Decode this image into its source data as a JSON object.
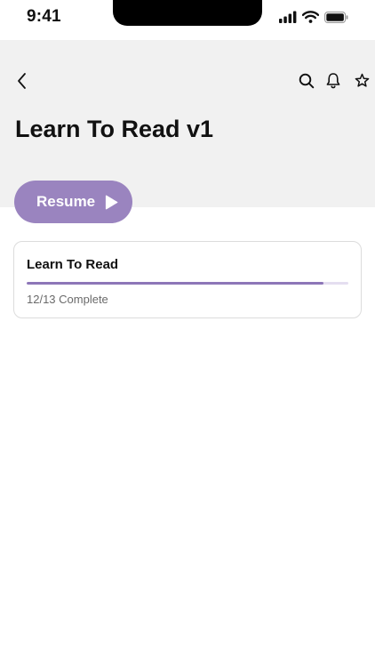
{
  "status_bar": {
    "time": "9:41",
    "icons": [
      "signal-icon",
      "wifi-icon",
      "battery-icon"
    ]
  },
  "nav": {
    "icons": [
      "back-chevron-icon",
      "search-icon",
      "bell-icon",
      "star-icon"
    ]
  },
  "page": {
    "title": "Learn To Read v1"
  },
  "resume_button": {
    "label": "Resume",
    "icon": "play-icon"
  },
  "course_card": {
    "title": "Learn To Read",
    "completed": 12,
    "total": 13,
    "status": "12/13 Complete"
  },
  "colors": {
    "accent": "#9a84bf",
    "progress": "#8d76b8",
    "header_bg": "#f1f1f1",
    "muted_text": "#6a6a6a"
  }
}
